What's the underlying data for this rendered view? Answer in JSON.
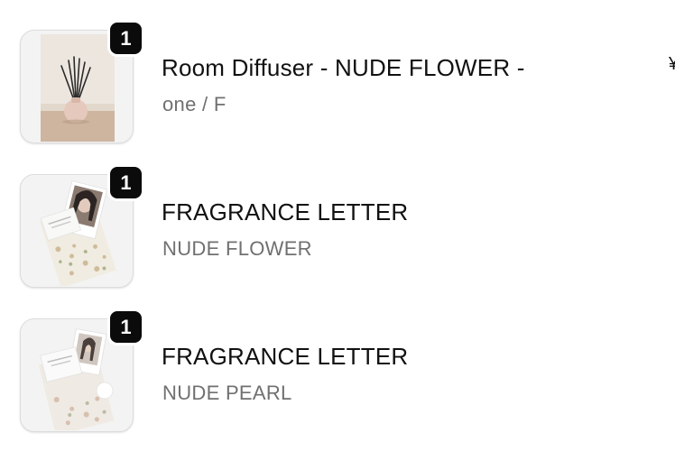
{
  "cart": {
    "items": [
      {
        "quantity": "1",
        "title": "Room Diffuser - NUDE FLOWER -",
        "variant": "one / F",
        "thumbnail_icon": "diffuser-product-image"
      },
      {
        "quantity": "1",
        "title": "FRAGRANCE LETTER",
        "variant": "NUDE FLOWER",
        "thumbnail_icon": "fragrance-letter-product-image"
      },
      {
        "quantity": "1",
        "title": "FRAGRANCE LETTER",
        "variant": "NUDE PEARL",
        "thumbnail_icon": "fragrance-letter-product-image"
      }
    ],
    "price_partial": "¥"
  },
  "colors": {
    "badge_bg": "#0b0b0b",
    "badge_text": "#ffffff",
    "title_text": "#111111",
    "variant_text": "#707070"
  }
}
